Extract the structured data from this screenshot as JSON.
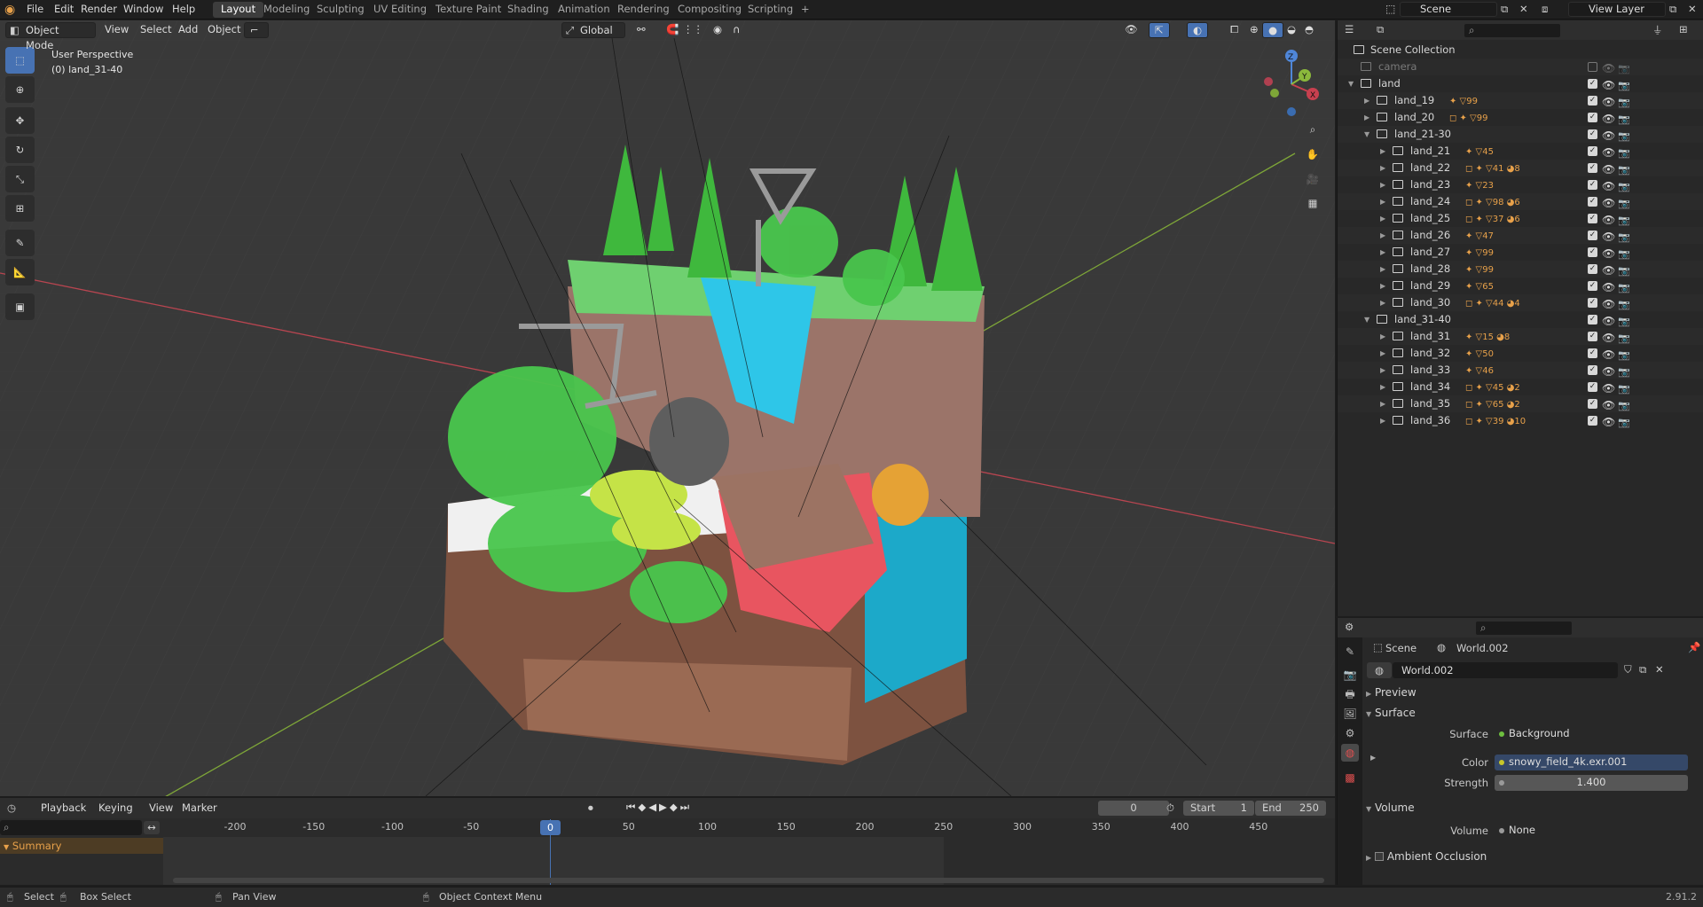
{
  "topbar": {
    "menus": [
      "File",
      "Edit",
      "Render",
      "Window",
      "Help"
    ],
    "workspaces": [
      "Layout",
      "Modeling",
      "Sculpting",
      "UV Editing",
      "Texture Paint",
      "Shading",
      "Animation",
      "Rendering",
      "Compositing",
      "Scripting"
    ],
    "active_workspace": "Layout",
    "add_tab": "+",
    "scene": "Scene",
    "view_layer": "View Layer"
  },
  "viewport": {
    "mode": "Object Mode",
    "menus": [
      "View",
      "Select",
      "Add",
      "Object"
    ],
    "transform_orientation": "Global",
    "overlay_title": "User Perspective",
    "overlay_subtitle": "(0) land_31-40",
    "gizmo": {
      "z": "Z",
      "y": "Y",
      "x": "X"
    }
  },
  "outliner": {
    "root": "Scene Collection",
    "rows": [
      {
        "name": "camera",
        "level": 1,
        "type": "collection",
        "dim": true,
        "expand": ""
      },
      {
        "name": "land",
        "level": 1,
        "type": "collection",
        "expand": "▼"
      },
      {
        "name": "land_19",
        "level": 2,
        "type": "collection",
        "expand": "▶",
        "children": "✦ ▽99"
      },
      {
        "name": "land_20",
        "level": 2,
        "type": "collection",
        "expand": "▶",
        "children": "◻ ✦ ▽99"
      },
      {
        "name": "land_21-30",
        "level": 2,
        "type": "collection",
        "expand": "▼"
      },
      {
        "name": "land_21",
        "level": 3,
        "type": "collection",
        "expand": "▶",
        "children": "✦ ▽45"
      },
      {
        "name": "land_22",
        "level": 3,
        "type": "collection",
        "expand": "▶",
        "children": "◻ ✦ ▽41 ◕8"
      },
      {
        "name": "land_23",
        "level": 3,
        "type": "collection",
        "expand": "▶",
        "children": "✦ ▽23"
      },
      {
        "name": "land_24",
        "level": 3,
        "type": "collection",
        "expand": "▶",
        "children": "◻ ✦ ▽98 ◕6"
      },
      {
        "name": "land_25",
        "level": 3,
        "type": "collection",
        "expand": "▶",
        "children": "◻ ✦ ▽37 ◕6"
      },
      {
        "name": "land_26",
        "level": 3,
        "type": "collection",
        "expand": "▶",
        "children": "✦ ▽47"
      },
      {
        "name": "land_27",
        "level": 3,
        "type": "collection",
        "expand": "▶",
        "children": "✦ ▽99"
      },
      {
        "name": "land_28",
        "level": 3,
        "type": "collection",
        "expand": "▶",
        "children": "✦ ▽99"
      },
      {
        "name": "land_29",
        "level": 3,
        "type": "collection",
        "expand": "▶",
        "children": "✦ ▽65"
      },
      {
        "name": "land_30",
        "level": 3,
        "type": "collection",
        "expand": "▶",
        "children": "◻ ✦ ▽44 ◕4"
      },
      {
        "name": "land_31-40",
        "level": 2,
        "type": "collection",
        "expand": "▼"
      },
      {
        "name": "land_31",
        "level": 3,
        "type": "collection",
        "expand": "▶",
        "children": "✦ ▽15 ◕8"
      },
      {
        "name": "land_32",
        "level": 3,
        "type": "collection",
        "expand": "▶",
        "children": "✦ ▽50"
      },
      {
        "name": "land_33",
        "level": 3,
        "type": "collection",
        "expand": "▶",
        "children": "✦ ▽46"
      },
      {
        "name": "land_34",
        "level": 3,
        "type": "collection",
        "expand": "▶",
        "children": "◻ ✦ ▽45 ◕2"
      },
      {
        "name": "land_35",
        "level": 3,
        "type": "collection",
        "expand": "▶",
        "children": "◻ ✦ ▽65 ◕2"
      },
      {
        "name": "land_36",
        "level": 3,
        "type": "collection",
        "expand": "▶",
        "children": "◻ ✦ ▽39 ◕10"
      }
    ]
  },
  "properties": {
    "breadcrumb_scene": "Scene",
    "breadcrumb_world": "World.002",
    "world_name": "World.002",
    "sections": {
      "preview": "Preview",
      "surface": "Surface",
      "volume": "Volume",
      "ao": "Ambient Occlusion"
    },
    "surface_label": "Surface",
    "surface_value": "Background",
    "color_label": "Color",
    "color_value": "snowy_field_4k.exr.001",
    "strength_label": "Strength",
    "strength_value": "1.400",
    "volume_label": "Volume",
    "volume_value": "None"
  },
  "timeline": {
    "menus": [
      "Playback",
      "Keying",
      "View",
      "Marker"
    ],
    "current_frame": "0",
    "start_label": "Start",
    "start": "1",
    "end_label": "End",
    "end": "250",
    "ticks": [
      "-200",
      "-150",
      "-100",
      "-50",
      "0",
      "50",
      "100",
      "150",
      "200",
      "250",
      "300",
      "350",
      "400",
      "450"
    ],
    "summary": "Summary"
  },
  "status": {
    "select": "Select",
    "box_select": "Box Select",
    "pan_view": "Pan View",
    "context_menu": "Object Context Menu",
    "version": "2.91.2"
  },
  "colors": {
    "accent": "#4772b3",
    "x_axis": "#c8404f",
    "y_axis": "#8bb83c",
    "z_axis": "#4f86d8",
    "playhead": "#4772b3"
  }
}
